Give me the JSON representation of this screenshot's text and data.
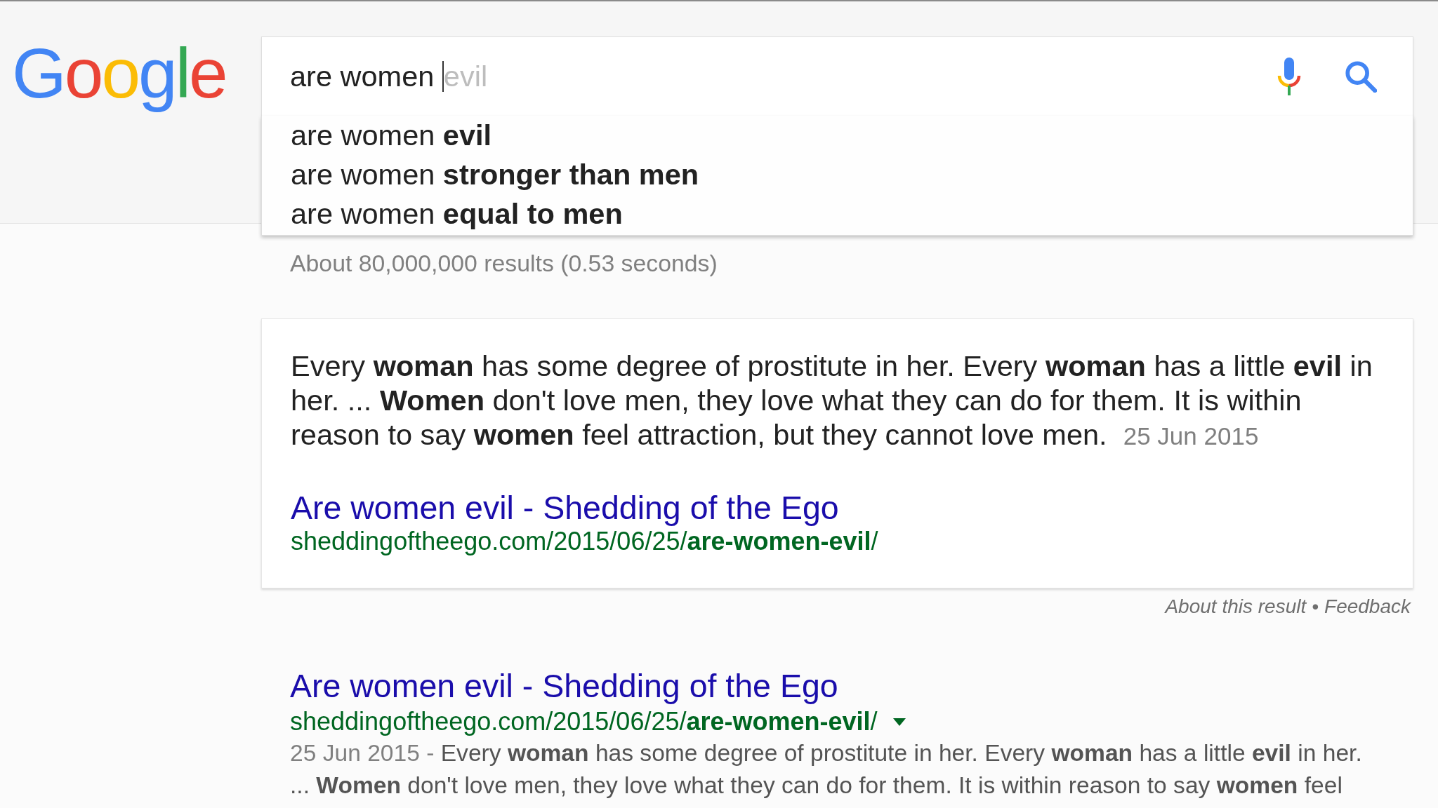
{
  "logo": {
    "text": "Google"
  },
  "search": {
    "value": "are women",
    "completion": "evil",
    "suggestions": [
      {
        "text": "are women **evil**"
      },
      {
        "text": "are women **stronger than men**"
      },
      {
        "text": "are women **equal to men**"
      }
    ]
  },
  "result_stats": "About 80,000,000 results (0.53 seconds)",
  "featured_snippet": {
    "text": "Every **woman** has some degree of prostitute in her. Every **woman** has a little **evil** in her. ... **Women** don't love men, they love what they can do for them. It is within reason to say **women** feel attraction, but they cannot love men.",
    "date": "25 Jun 2015",
    "title": "Are women evil - Shedding of the Ego",
    "url": "sheddingoftheego.com/2015/06/25/**are-women-evil**/"
  },
  "snippet_footer": {
    "about": "About this result",
    "separator": "•",
    "feedback": "Feedback"
  },
  "results": [
    {
      "title": "Are women evil - Shedding of the Ego",
      "url": "sheddingoftheego.com/2015/06/25/**are-women-evil**/",
      "menu_arrow": true,
      "date": "25 Jun 2015",
      "date_separator": "-",
      "snippet": "Every **woman** has some degree of prostitute in her. Every **woman** has a little **evil** in her. ... **Women** don't love men, they love what they can do for them. It is within reason to say **women** feel"
    }
  ]
}
